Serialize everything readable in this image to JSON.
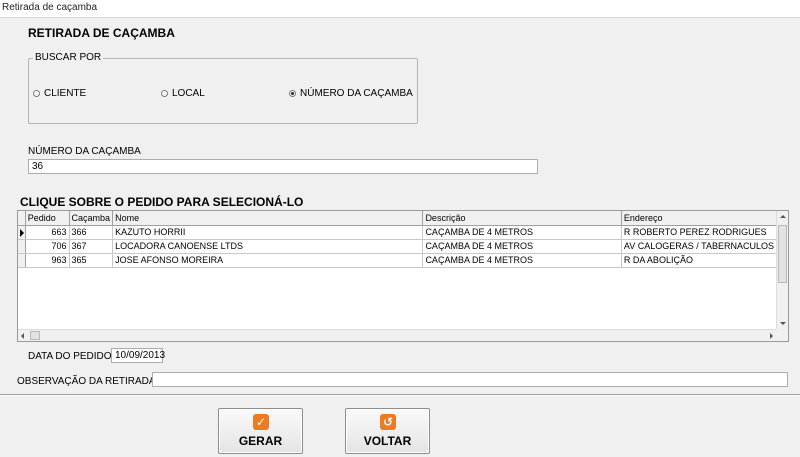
{
  "window": {
    "title": "Retirada de caçamba"
  },
  "form": {
    "title": "RETIRADA DE CAÇAMBA"
  },
  "search": {
    "group_label": "BUSCAR POR",
    "options": [
      {
        "label": "CLIENTE",
        "selected": false
      },
      {
        "label": "LOCAL",
        "selected": false
      },
      {
        "label": "NÚMERO DA CAÇAMBA",
        "selected": true
      }
    ]
  },
  "numero": {
    "label": "NÚMERO DA CAÇAMBA",
    "value": "36"
  },
  "grid": {
    "title": "CLIQUE SOBRE O PEDIDO PARA SELECIONÁ-LO",
    "columns": [
      "Pedido",
      "Caçamba",
      "Nome",
      "Descrição",
      "Endereço"
    ],
    "rows": [
      {
        "pedido": "663",
        "cacamba": "366",
        "nome": "KAZUTO HORRII",
        "descricao": "CAÇAMBA DE 4 METROS",
        "endereco": "R ROBERTO PEREZ RODRIGUES"
      },
      {
        "pedido": "706",
        "cacamba": "367",
        "nome": "LOCADORA CANOENSE LTDS",
        "descricao": "CAÇAMBA DE 4 METROS",
        "endereco": "AV CALOGERAS / TABERNACULOS BI"
      },
      {
        "pedido": "963",
        "cacamba": "365",
        "nome": "JOSE AFONSO MOREIRA",
        "descricao": "CAÇAMBA DE 4 METROS",
        "endereco": "R DA ABOLIÇÃO"
      }
    ]
  },
  "data_pedido": {
    "label": "DATA DO PEDIDO",
    "value": "10/09/2013"
  },
  "observacao": {
    "label": "OBSERVAÇÃO DA RETIRADA:",
    "value": ""
  },
  "buttons": {
    "gerar": {
      "label": "GERAR",
      "icon": "check-icon"
    },
    "voltar": {
      "label": "VOLTAR",
      "icon": "back-arrow-icon"
    }
  },
  "colors": {
    "button_icon": "#ee7b21"
  }
}
